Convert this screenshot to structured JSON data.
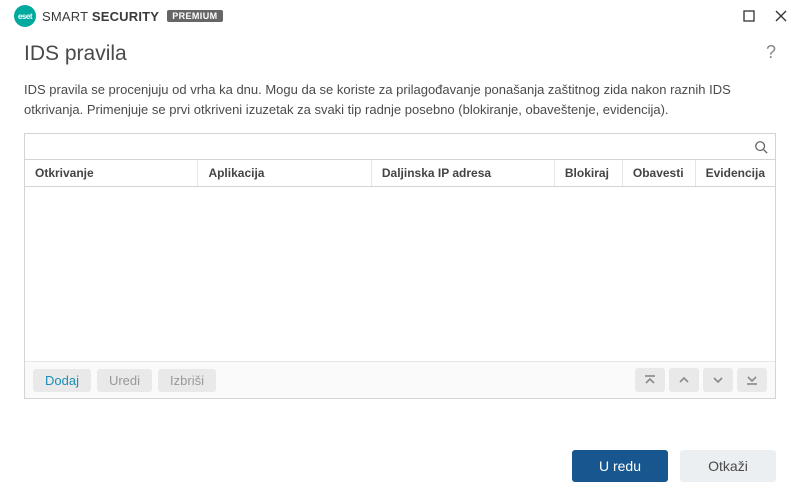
{
  "brand": {
    "logo_text": "eset",
    "name_prefix": "SMART ",
    "name_bold": "SECURITY",
    "badge": "PREMIUM"
  },
  "header": {
    "title": "IDS pravila",
    "help": "?"
  },
  "description": "IDS pravila se procenjuju od vrha ka dnu. Mogu da se koriste za prilagođavanje ponašanja zaštitnog zida nakon raznih IDS otkrivanja. Primenjuje se prvi otkriveni izuzetak za svaki tip radnje posebno (blokiranje, obaveštenje, evidencija).",
  "search": {
    "placeholder": ""
  },
  "columns": {
    "detection": "Otkrivanje",
    "application": "Aplikacija",
    "remote_ip": "Daljinska IP adresa",
    "block": "Blokiraj",
    "notify": "Obavesti",
    "log": "Evidencija"
  },
  "actions": {
    "add": "Dodaj",
    "edit": "Uredi",
    "delete": "Izbriši"
  },
  "footer": {
    "ok": "U redu",
    "cancel": "Otkaži"
  }
}
